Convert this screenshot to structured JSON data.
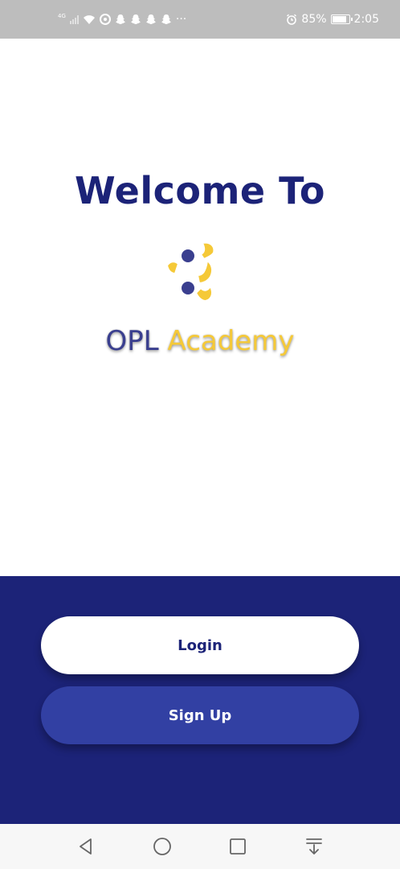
{
  "status_bar": {
    "network": "4G",
    "battery": "85%",
    "battery_level": 0.85,
    "time": "2:05",
    "more": "···",
    "icons": [
      "signal-icon",
      "wifi-icon",
      "sync-icon",
      "snapchat-icon",
      "snapchat-icon",
      "snapchat-icon",
      "snapchat-icon",
      "alarm-icon",
      "battery-icon"
    ]
  },
  "welcome": {
    "title": "Welcome To"
  },
  "logo": {
    "part1": "OPL",
    "part2": "Academy",
    "colors": {
      "primary": "#3a3f8f",
      "accent": "#f5c938"
    }
  },
  "actions": {
    "login_label": "Login",
    "signup_label": "Sign Up"
  },
  "nav_bar": {
    "icons": [
      "back-icon",
      "home-icon",
      "recents-icon",
      "notification-pull-icon"
    ]
  },
  "colors": {
    "brand_dark": "#1c2378",
    "signup_button": "#3240a3",
    "status_bar": "#bdbdbd"
  }
}
